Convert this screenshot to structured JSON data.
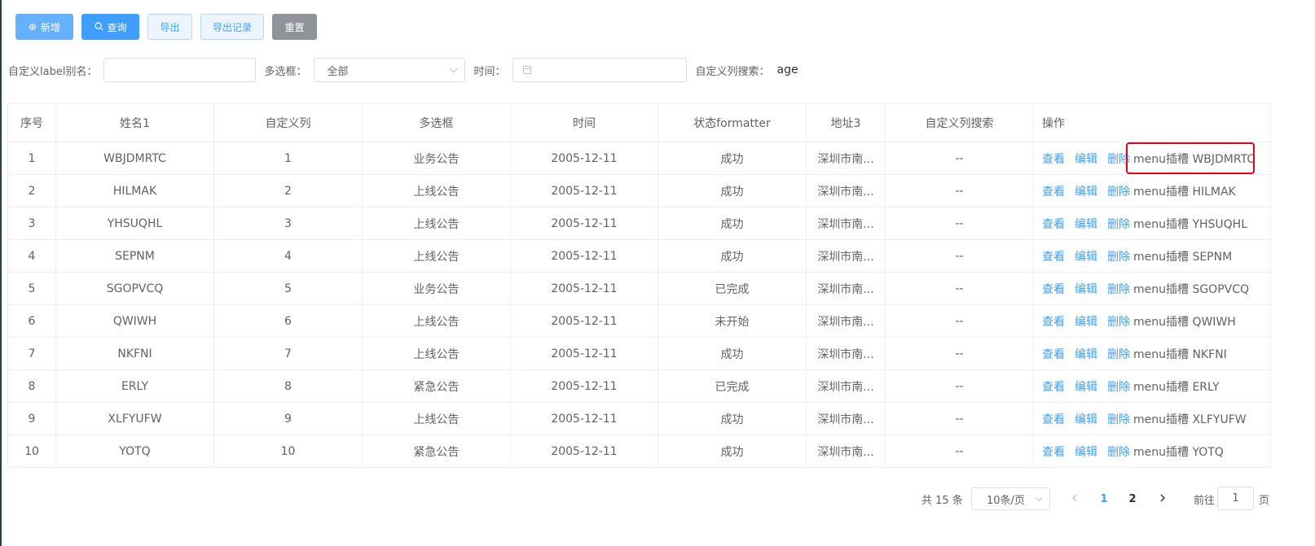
{
  "toolbar": {
    "add_label": "新增",
    "query_label": "查询",
    "export_label": "导出",
    "export_log_label": "导出记录",
    "reset_label": "重置"
  },
  "search": {
    "name_label": "自定义label别名：",
    "name_value": "",
    "select_label": "多选框：",
    "select_value": "全部",
    "date_label": "时间：",
    "date_value": "",
    "custom_label": "自定义列搜索：",
    "custom_value": "age"
  },
  "table": {
    "headers": [
      "序号",
      "姓名1",
      "自定义列",
      "多选框",
      "时间",
      "状态formatter",
      "地址3",
      "自定义列搜索",
      "操作"
    ],
    "actions": {
      "view": "查看",
      "edit": "编辑",
      "delete": "删除"
    },
    "rows": [
      {
        "index": "1",
        "name": "WBJDMRTC",
        "custom": "1",
        "multi": "业务公告",
        "time": "2005-12-11",
        "status": "成功",
        "address": "深圳市南...",
        "custom_search": "--",
        "slot": "menu插槽 WBJDMRTC"
      },
      {
        "index": "2",
        "name": "HILMAK",
        "custom": "2",
        "multi": "上线公告",
        "time": "2005-12-11",
        "status": "成功",
        "address": "深圳市南...",
        "custom_search": "--",
        "slot": "menu插槽 HILMAK"
      },
      {
        "index": "3",
        "name": "YHSUQHL",
        "custom": "3",
        "multi": "上线公告",
        "time": "2005-12-11",
        "status": "成功",
        "address": "深圳市南...",
        "custom_search": "--",
        "slot": "menu插槽 YHSUQHL"
      },
      {
        "index": "4",
        "name": "SEPNM",
        "custom": "4",
        "multi": "上线公告",
        "time": "2005-12-11",
        "status": "成功",
        "address": "深圳市南...",
        "custom_search": "--",
        "slot": "menu插槽 SEPNM"
      },
      {
        "index": "5",
        "name": "SGOPVCQ",
        "custom": "5",
        "multi": "业务公告",
        "time": "2005-12-11",
        "status": "已完成",
        "address": "深圳市南...",
        "custom_search": "--",
        "slot": "menu插槽 SGOPVCQ"
      },
      {
        "index": "6",
        "name": "QWIWH",
        "custom": "6",
        "multi": "上线公告",
        "time": "2005-12-11",
        "status": "未开始",
        "address": "深圳市南...",
        "custom_search": "--",
        "slot": "menu插槽 QWIWH"
      },
      {
        "index": "7",
        "name": "NKFNI",
        "custom": "7",
        "multi": "上线公告",
        "time": "2005-12-11",
        "status": "成功",
        "address": "深圳市南...",
        "custom_search": "--",
        "slot": "menu插槽 NKFNI"
      },
      {
        "index": "8",
        "name": "ERLY",
        "custom": "8",
        "multi": "紧急公告",
        "time": "2005-12-11",
        "status": "已完成",
        "address": "深圳市南...",
        "custom_search": "--",
        "slot": "menu插槽 ERLY"
      },
      {
        "index": "9",
        "name": "XLFYUFW",
        "custom": "9",
        "multi": "上线公告",
        "time": "2005-12-11",
        "status": "成功",
        "address": "深圳市南...",
        "custom_search": "--",
        "slot": "menu插槽 XLFYUFW"
      },
      {
        "index": "10",
        "name": "YOTQ",
        "custom": "10",
        "multi": "紧急公告",
        "time": "2005-12-11",
        "status": "成功",
        "address": "深圳市南...",
        "custom_search": "--",
        "slot": "menu插槽 YOTQ"
      }
    ]
  },
  "pagination": {
    "total": "共 15 条",
    "page_size": "10条/页",
    "pages": [
      "1",
      "2"
    ],
    "current_page": "1",
    "jump_prefix": "前往",
    "jump_value": "1",
    "jump_suffix": "页"
  },
  "colors": {
    "primary": "#409eff",
    "primary_light": "#66b1ff",
    "info": "#909399",
    "highlight": "#e1001e"
  }
}
